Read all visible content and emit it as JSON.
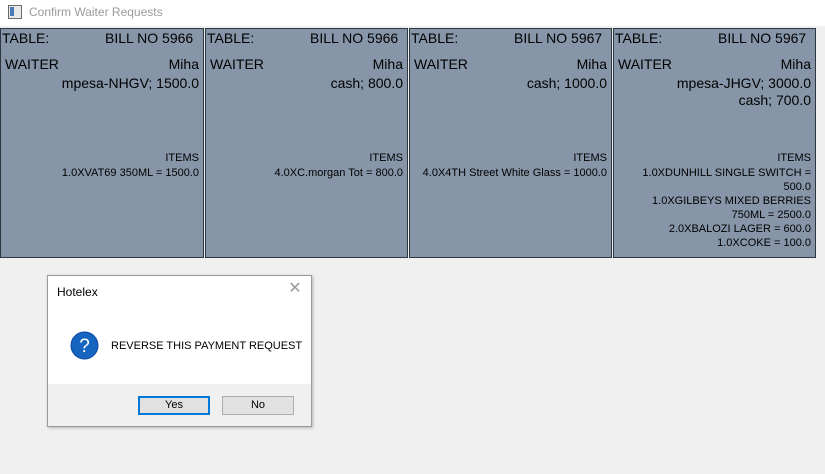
{
  "window": {
    "title": "Confirm Waiter Requests"
  },
  "cards": [
    {
      "table_label": "TABLE:",
      "bill_label": "BILL  NO 5966",
      "waiter_label": "WAITER",
      "waiter_name": "Miha",
      "payments": [
        "mpesa-NHGV; 1500.0"
      ],
      "items_header": "ITEMS",
      "items": [
        "1.0XVAT69 350ML = 1500.0"
      ]
    },
    {
      "table_label": "TABLE:",
      "bill_label": "BILL  NO 5966",
      "waiter_label": "WAITER",
      "waiter_name": "Miha",
      "payments": [
        "cash; 800.0"
      ],
      "items_header": "ITEMS",
      "items": [
        "4.0XC.morgan Tot = 800.0"
      ]
    },
    {
      "table_label": "TABLE:",
      "bill_label": "BILL  NO 5967",
      "waiter_label": "WAITER",
      "waiter_name": "Miha",
      "payments": [
        "cash; 1000.0"
      ],
      "items_header": "ITEMS",
      "items": [
        "4.0X4TH Street White Glass = 1000.0"
      ]
    },
    {
      "table_label": "TABLE:",
      "bill_label": "BILL  NO 5967",
      "waiter_label": "WAITER",
      "waiter_name": "Miha",
      "payments": [
        "mpesa-JHGV; 3000.0",
        "cash; 700.0"
      ],
      "items_header": "ITEMS",
      "items": [
        "1.0XDUNHILL SINGLE SWITCH = 500.0",
        "1.0XGILBEYS MIXED BERRIES 750ML = 2500.0",
        "2.0XBALOZI LAGER = 600.0",
        "1.0XCOKE = 100.0"
      ]
    }
  ],
  "dialog": {
    "title": "Hotelex",
    "close_glyph": "✕",
    "icon": "question-icon",
    "message": "REVERSE THIS PAYMENT REQUEST",
    "yes_label": "Yes",
    "no_label": "No"
  },
  "colors": {
    "card_bg": "#8696a8",
    "dialog_focus": "#0078d7",
    "question_icon": "#1565c0"
  }
}
